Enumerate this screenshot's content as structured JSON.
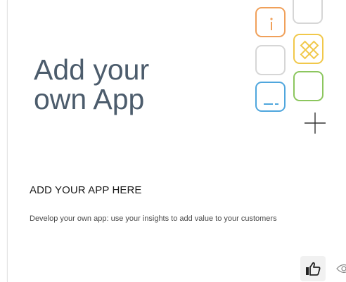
{
  "card": {
    "hero_title": "Add your\nown App",
    "heading": "ADD YOUR APP HERE",
    "description": "Develop your own app: use your insights to add value to your customers"
  },
  "illustration": {
    "tiles": [
      {
        "name": "info-tile",
        "color": "#f0a05a",
        "icon": "info-icon"
      },
      {
        "name": "blank-top-tile",
        "color": "#d6d6d6",
        "icon": ""
      },
      {
        "name": "tools-tile",
        "color": "#f1c84a",
        "icon": "ruler-pencil-icon"
      },
      {
        "name": "blank-middle-tile",
        "color": "#d6d6d6",
        "icon": ""
      },
      {
        "name": "terminal-tile",
        "color": "#4fa6dd",
        "icon": "terminal-icon"
      },
      {
        "name": "green-tile",
        "color": "#8cc65e",
        "icon": ""
      }
    ],
    "plus_icon": "plus-icon"
  },
  "actions": {
    "like_icon": "thumbs-up-icon",
    "view_icon": "eye-icon"
  },
  "colors": {
    "title": "#4c5c6c",
    "heading": "#1b1b1b",
    "text": "#4a4a4a"
  }
}
